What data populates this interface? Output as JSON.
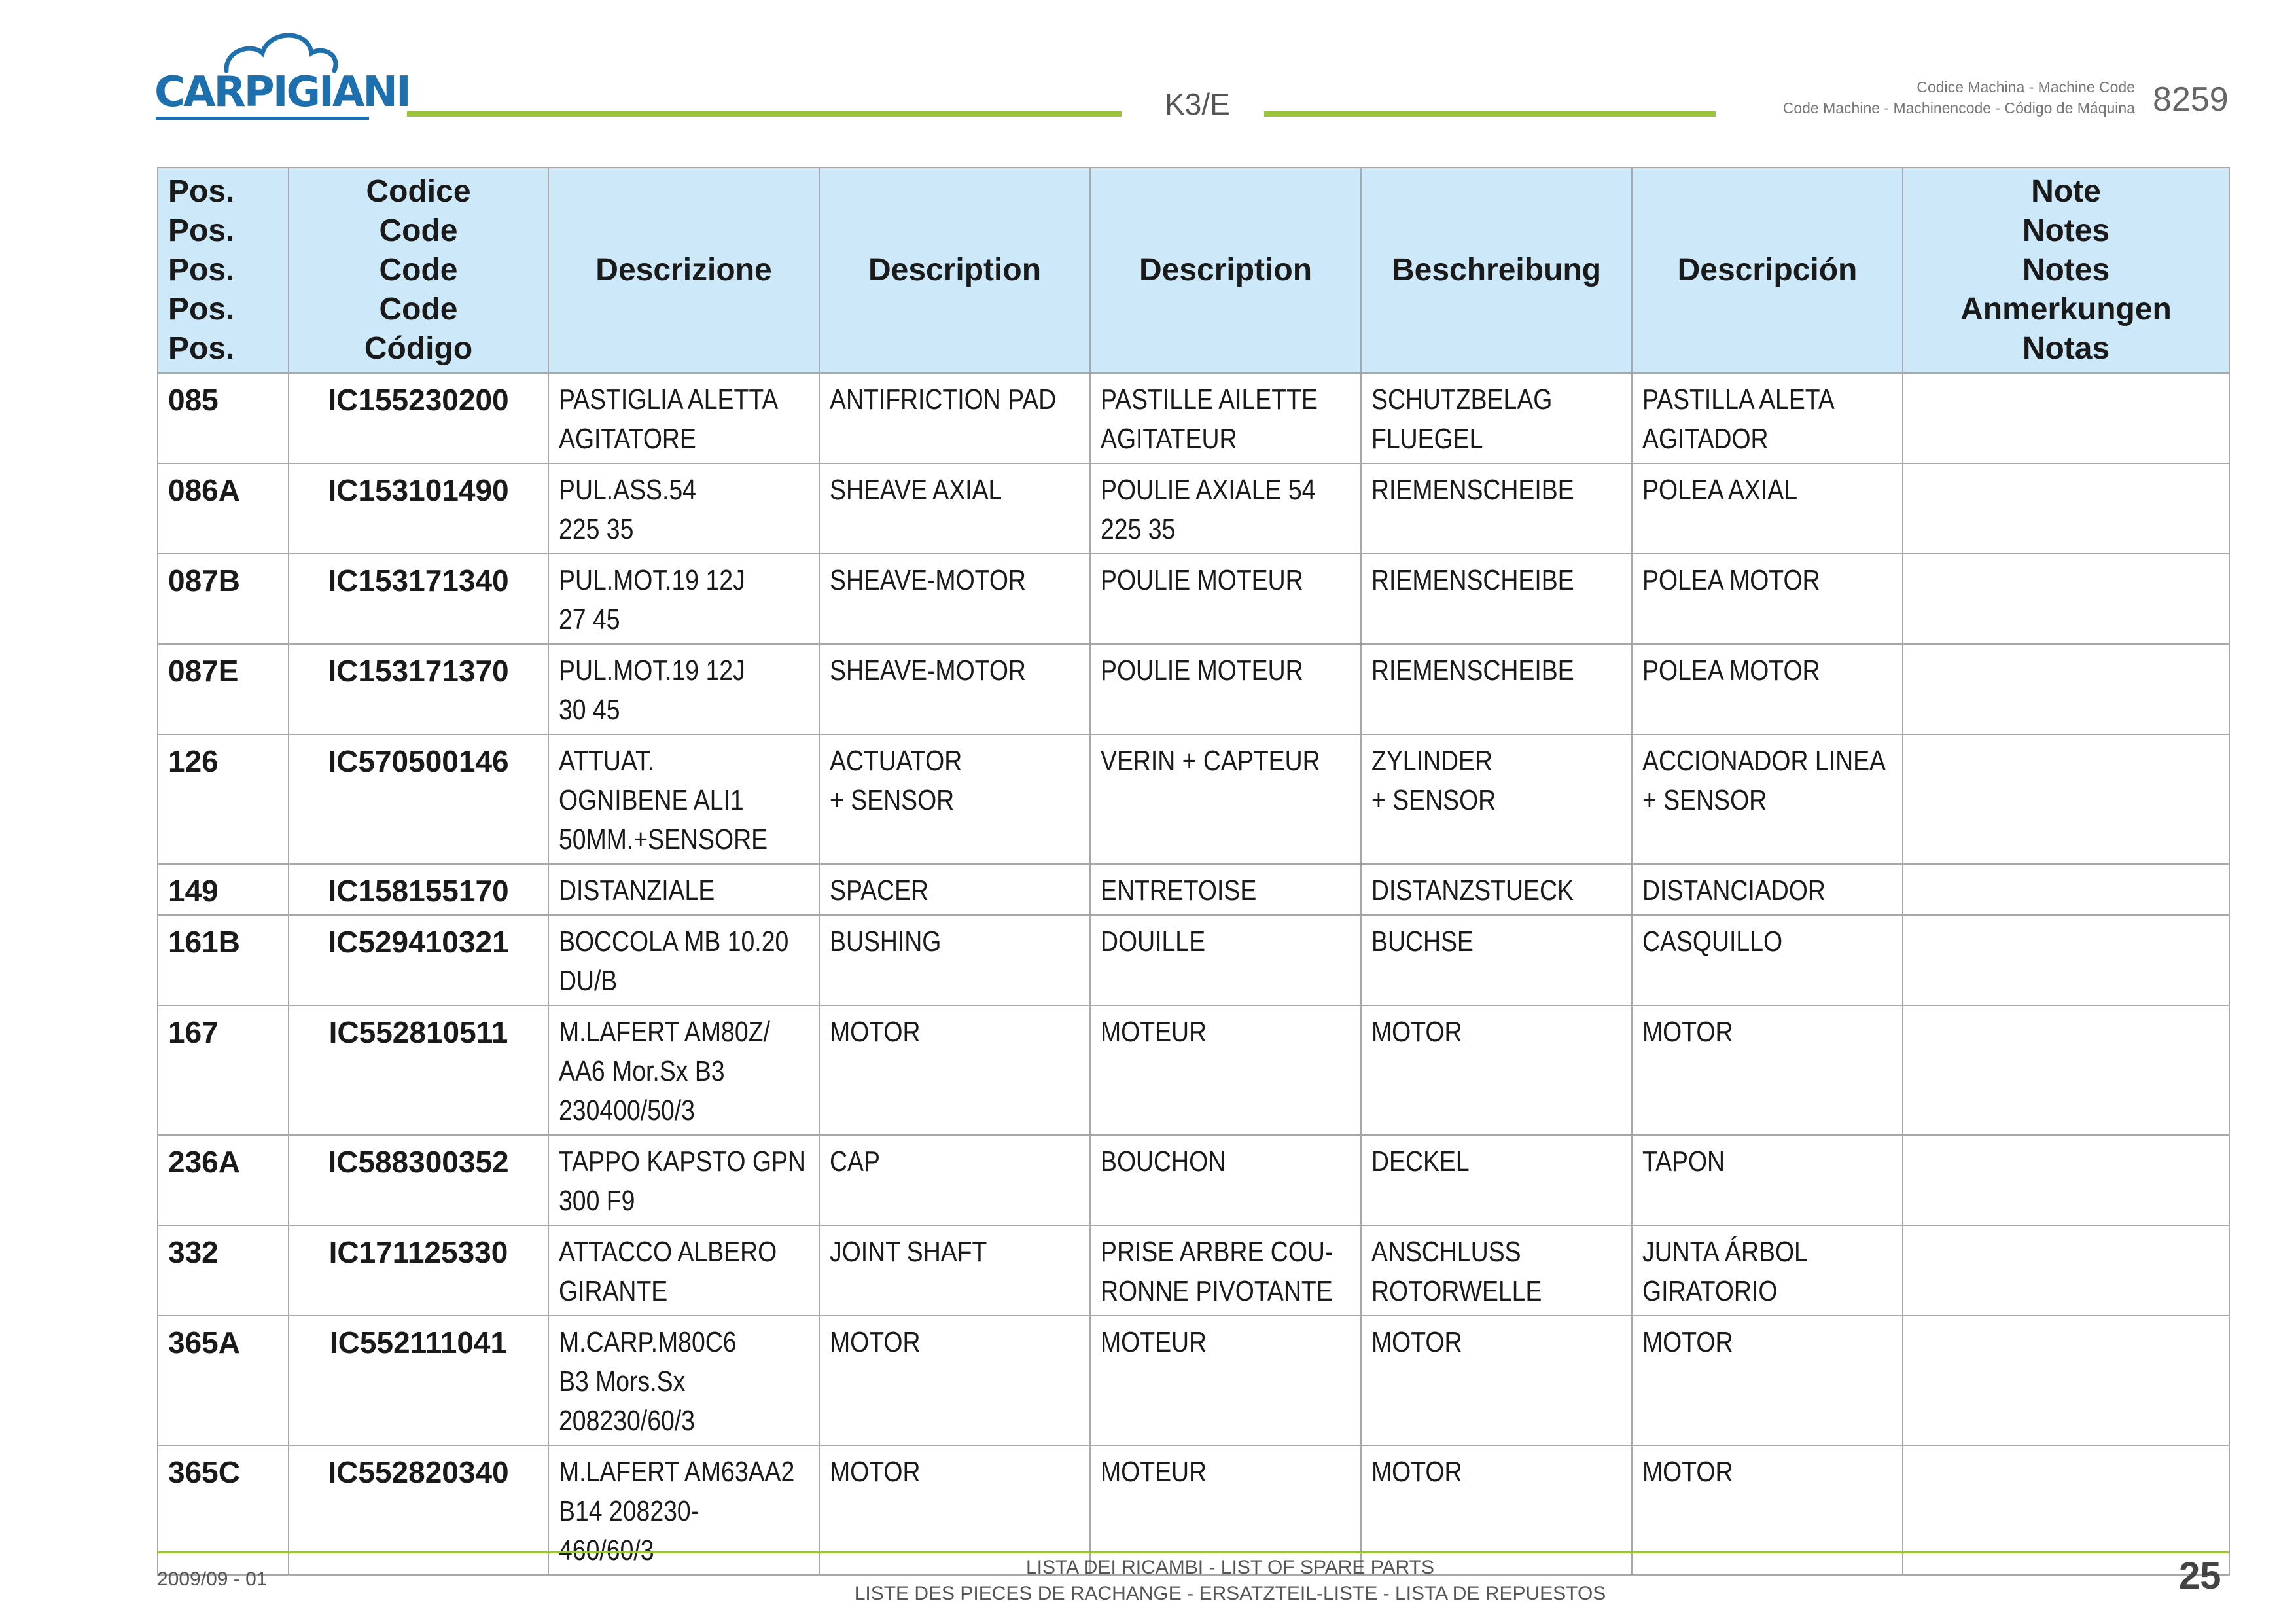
{
  "header": {
    "brand": "CARPIGIANI",
    "model": "K3/E",
    "machine_code_label_1": "Codice Machina - Machine Code",
    "machine_code_label_2": "Code Machine - Machinencode - Código de Máquina",
    "machine_code": "8259",
    "colors": {
      "brand_blue": "#1e6fae",
      "accent_green": "#9ac43c",
      "header_bg": "#cde8f8"
    }
  },
  "table": {
    "headers": {
      "pos": "Pos.\nPos.\nPos.\nPos.\nPos.",
      "code": "Codice\nCode\nCode\nCode\nCódigo",
      "it": "Descrizione",
      "en": "Description",
      "fr": "Description",
      "de": "Beschreibung",
      "es": "Descripción",
      "notes": "Note\nNotes\nNotes\nAnmerkungen\nNotas"
    },
    "rows": [
      {
        "pos": "085",
        "code": "IC155230200",
        "it": "PASTIGLIA ALETTA\nAGITATORE",
        "en": "ANTIFRICTION PAD",
        "fr": "PASTILLE AILETTE\nAGITATEUR",
        "de": "SCHUTZBELAG\nFLUEGEL",
        "es": "PASTILLA ALETA\nAGITADOR",
        "notes": ""
      },
      {
        "pos": "086A",
        "code": "IC153101490",
        "it": "PUL.ASS.54\n225  35",
        "en": "SHEAVE AXIAL",
        "fr": "POULIE AXIALE 54\n225  35",
        "de": "RIEMENSCHEIBE",
        "es": "POLEA AXIAL",
        "notes": ""
      },
      {
        "pos": "087B",
        "code": "IC153171340",
        "it": "PUL.MOT.19     12J\n27  45",
        "en": "SHEAVE-MOTOR",
        "fr": "POULIE MOTEUR",
        "de": "RIEMENSCHEIBE",
        "es": "POLEA MOTOR",
        "notes": ""
      },
      {
        "pos": "087E",
        "code": "IC153171370",
        "it": "PUL.MOT.19     12J\n30  45",
        "en": "SHEAVE-MOTOR",
        "fr": "POULIE MOTEUR",
        "de": "RIEMENSCHEIBE",
        "es": "POLEA MOTOR",
        "notes": ""
      },
      {
        "pos": "126",
        "code": "IC570500146",
        "it": "ATTUAT.\nOGNIBENE ALI1\n50MM.+SENSORE",
        "en": "ACTUATOR\n+ SENSOR",
        "fr": "VERIN + CAPTEUR",
        "de": "ZYLINDER\n+ SENSOR",
        "es": "ACCIONADOR LINEA\n+ SENSOR",
        "notes": ""
      },
      {
        "pos": "149",
        "code": "IC158155170",
        "it": "DISTANZIALE",
        "en": "SPACER",
        "fr": "ENTRETOISE",
        "de": "DISTANZSTUECK",
        "es": "DISTANCIADOR",
        "notes": ""
      },
      {
        "pos": "161B",
        "code": "IC529410321",
        "it": "BOCCOLA MB 10.20\nDU/B",
        "en": "BUSHING",
        "fr": "DOUILLE",
        "de": "BUCHSE",
        "es": "CASQUILLO",
        "notes": ""
      },
      {
        "pos": "167",
        "code": "IC552810511",
        "it": "M.LAFERT AM80Z/\nAA6 Mor.Sx B3\n230400/50/3",
        "en": "MOTOR",
        "fr": "MOTEUR",
        "de": "MOTOR",
        "es": "MOTOR",
        "notes": ""
      },
      {
        "pos": "236A",
        "code": "IC588300352",
        "it": "TAPPO KAPSTO GPN\n300 F9",
        "en": "CAP",
        "fr": "BOUCHON",
        "de": "DECKEL",
        "es": "TAPON",
        "notes": ""
      },
      {
        "pos": "332",
        "code": "IC171125330",
        "it": "ATTACCO ALBERO\nGIRANTE",
        "en": "JOINT SHAFT",
        "fr": "PRISE ARBRE COU-\nRONNE PIVOTANTE",
        "de": "ANSCHLUSS\nROTORWELLE",
        "es": "JUNTA ÁRBOL\nGIRATORIO",
        "notes": ""
      },
      {
        "pos": "365A",
        "code": "IC552111041",
        "it": "M.CARP.M80C6\nB3 Mors.Sx\n208230/60/3",
        "en": "MOTOR",
        "fr": "MOTEUR",
        "de": "MOTOR",
        "es": "MOTOR",
        "notes": ""
      },
      {
        "pos": "365C",
        "code": "IC552820340",
        "it": "M.LAFERT AM63AA2\nB14     208230-\n460/60/3",
        "en": "MOTOR",
        "fr": "MOTEUR",
        "de": "MOTOR",
        "es": "MOTOR",
        "notes": ""
      }
    ]
  },
  "footer": {
    "date": "2009/09 - 01",
    "line1": "LISTA DEI RICAMBI - LIST OF SPARE PARTS",
    "line2": "LISTE DES PIECES DE RACHANGE - ERSATZTEIL-LISTE - LISTA DE REPUESTOS",
    "page": "25"
  }
}
